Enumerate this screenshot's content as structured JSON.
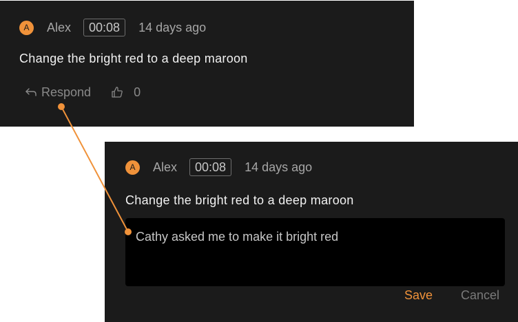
{
  "colors": {
    "accent": "#f0923a",
    "card_background": "#1b1b1b",
    "input_background": "#000000"
  },
  "original_comment": {
    "avatar_initial": "A",
    "author": "Alex",
    "timestamp": "00:08",
    "age": "14 days ago",
    "text": "Change the bright red to a deep maroon",
    "respond_label": "Respond",
    "respond_icon": "reply-arrow-icon",
    "like_icon": "thumbs-up-icon",
    "like_count": "0"
  },
  "reply_form": {
    "avatar_initial": "A",
    "author": "Alex",
    "timestamp": "00:08",
    "age": "14 days ago",
    "text": "Change the bright red to a deep maroon",
    "reply_value": "Cathy asked me to make it bright red",
    "save_label": "Save",
    "cancel_label": "Cancel"
  }
}
